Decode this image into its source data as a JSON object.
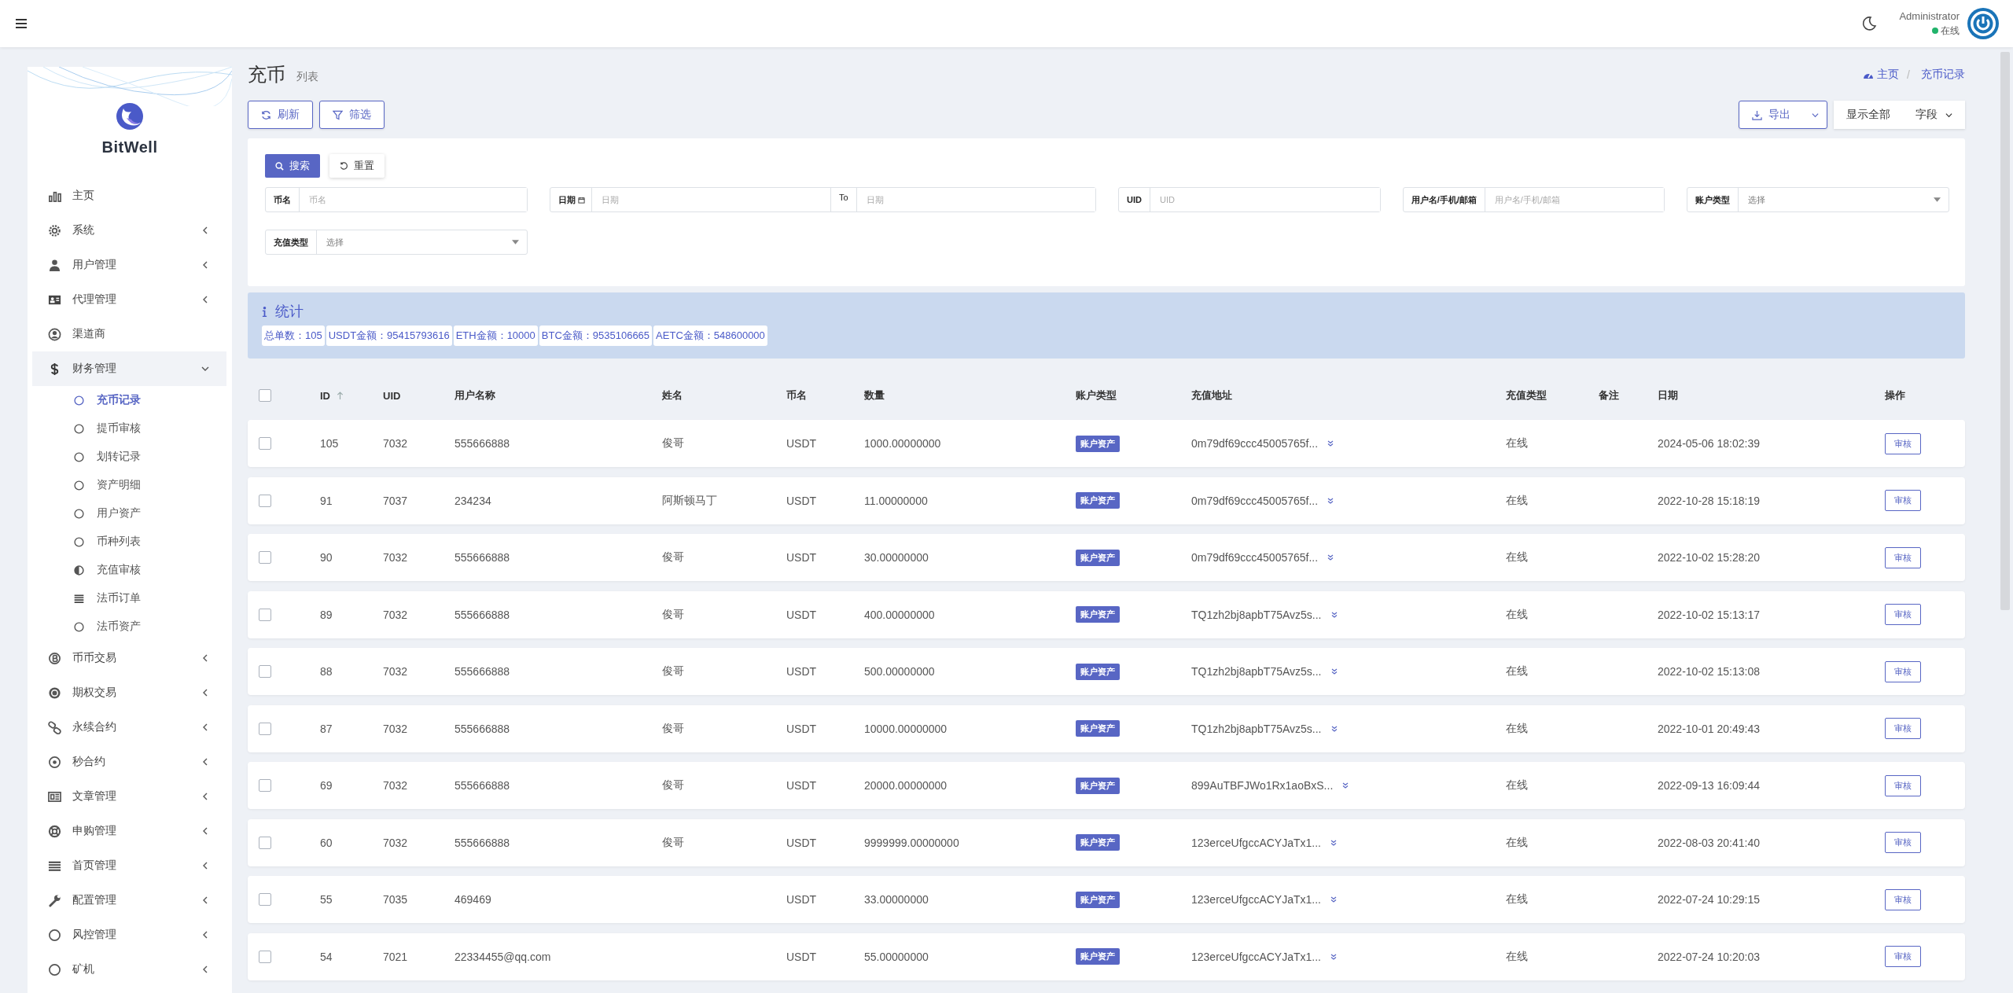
{
  "header": {
    "user": "Administrator",
    "status": "在线",
    "online": true
  },
  "sidebar": {
    "brand": "BitWell",
    "items": [
      {
        "label": "主页",
        "expandable": false
      },
      {
        "label": "系统",
        "expandable": true,
        "expanded": false
      },
      {
        "label": "用户管理",
        "expandable": true,
        "expanded": false
      },
      {
        "label": "代理管理",
        "expandable": true,
        "expanded": false
      },
      {
        "label": "渠道商",
        "expandable": false
      },
      {
        "label": "财务管理",
        "expandable": true,
        "expanded": true,
        "children": [
          {
            "label": "充币记录",
            "selected": true
          },
          {
            "label": "提币审核",
            "selected": false
          },
          {
            "label": "划转记录",
            "selected": false
          },
          {
            "label": "资产明细",
            "selected": false
          },
          {
            "label": "用户资产",
            "selected": false
          },
          {
            "label": "币种列表",
            "selected": false
          },
          {
            "label": "充值审核",
            "selected": false
          },
          {
            "label": "法币订单",
            "selected": false
          },
          {
            "label": "法币资产",
            "selected": false
          }
        ]
      },
      {
        "label": "币币交易",
        "expandable": true,
        "expanded": false
      },
      {
        "label": "期权交易",
        "expandable": true,
        "expanded": false
      },
      {
        "label": "永续合约",
        "expandable": true,
        "expanded": false
      },
      {
        "label": "秒合约",
        "expandable": true,
        "expanded": false
      },
      {
        "label": "文章管理",
        "expandable": true,
        "expanded": false
      },
      {
        "label": "申购管理",
        "expandable": true,
        "expanded": false
      },
      {
        "label": "首页管理",
        "expandable": true,
        "expanded": false
      },
      {
        "label": "配置管理",
        "expandable": true,
        "expanded": false
      },
      {
        "label": "风控管理",
        "expandable": true,
        "expanded": false
      },
      {
        "label": "矿机",
        "expandable": true,
        "expanded": false
      }
    ]
  },
  "page": {
    "title": "充币",
    "subtitle": "列表",
    "breadcrumb": {
      "separator": "/",
      "items": [
        "主页",
        "充币记录"
      ]
    }
  },
  "toolbar": {
    "left": [
      "刷新",
      "筛选"
    ],
    "export": "导出",
    "show_all": "显示全部",
    "fields": "字段"
  },
  "filter": {
    "search": "搜索",
    "reset": "重置",
    "fields": [
      {
        "kind": "text",
        "label": "币名",
        "placeholder": "币名"
      },
      {
        "kind": "daterange",
        "label": "日期",
        "placeholder": "日期",
        "to_label": "To",
        "to_placeholder": "日期"
      },
      {
        "kind": "text",
        "label": "UID",
        "placeholder": "UID"
      },
      {
        "kind": "text",
        "label": "用户名/手机/邮箱",
        "placeholder": "用户名/手机/邮箱"
      },
      {
        "kind": "select",
        "label": "账户类型",
        "placeholder": "选择"
      },
      {
        "kind": "select",
        "label": "充值类型",
        "placeholder": "选择"
      }
    ]
  },
  "stats": {
    "title": "统计",
    "items": [
      "总单数：105",
      "USDT金额：95415793616",
      "ETH金额：10000",
      "BTC金额：9535106665",
      "AETC金额：548600000"
    ]
  },
  "table": {
    "all_checked": false,
    "columns": [
      {
        "label": "ID",
        "sortable": true
      },
      {
        "label": "UID",
        "sortable": false
      },
      {
        "label": "用户名称",
        "sortable": false
      },
      {
        "label": "姓名",
        "sortable": false
      },
      {
        "label": "币名",
        "sortable": false
      },
      {
        "label": "数量",
        "sortable": false
      },
      {
        "label": "账户类型",
        "sortable": false
      },
      {
        "label": "充值地址",
        "sortable": false
      },
      {
        "label": "充值类型",
        "sortable": false
      },
      {
        "label": "备注",
        "sortable": false
      },
      {
        "label": "日期",
        "sortable": false
      },
      {
        "label": "操作",
        "sortable": false
      }
    ],
    "rows": [
      {
        "checked": false,
        "id": "105",
        "uid": "7032",
        "username": "555666888",
        "name": "俊哥",
        "coin": "USDT",
        "amount": "1000.00000000",
        "account_type": "账户资产",
        "address": "0m79df69ccc45005765f...",
        "deposit_type": "在线",
        "date": "2024-05-06 18:02:39",
        "action": "审核"
      },
      {
        "checked": false,
        "id": "91",
        "uid": "7037",
        "username": "234234",
        "name": "阿斯顿马丁",
        "coin": "USDT",
        "amount": "11.00000000",
        "account_type": "账户资产",
        "address": "0m79df69ccc45005765f...",
        "deposit_type": "在线",
        "date": "2022-10-28 15:18:19",
        "action": "审核"
      },
      {
        "checked": false,
        "id": "90",
        "uid": "7032",
        "username": "555666888",
        "name": "俊哥",
        "coin": "USDT",
        "amount": "30.00000000",
        "account_type": "账户资产",
        "address": "0m79df69ccc45005765f...",
        "deposit_type": "在线",
        "date": "2022-10-02 15:28:20",
        "action": "审核"
      },
      {
        "checked": false,
        "id": "89",
        "uid": "7032",
        "username": "555666888",
        "name": "俊哥",
        "coin": "USDT",
        "amount": "400.00000000",
        "account_type": "账户资产",
        "address": "TQ1zh2bj8apbT75Avz5s...",
        "deposit_type": "在线",
        "date": "2022-10-02 15:13:17",
        "action": "审核"
      },
      {
        "checked": false,
        "id": "88",
        "uid": "7032",
        "username": "555666888",
        "name": "俊哥",
        "coin": "USDT",
        "amount": "500.00000000",
        "account_type": "账户资产",
        "address": "TQ1zh2bj8apbT75Avz5s...",
        "deposit_type": "在线",
        "date": "2022-10-02 15:13:08",
        "action": "审核"
      },
      {
        "checked": false,
        "id": "87",
        "uid": "7032",
        "username": "555666888",
        "name": "俊哥",
        "coin": "USDT",
        "amount": "10000.00000000",
        "account_type": "账户资产",
        "address": "TQ1zh2bj8apbT75Avz5s...",
        "deposit_type": "在线",
        "date": "2022-10-01 20:49:43",
        "action": "审核"
      },
      {
        "checked": false,
        "id": "69",
        "uid": "7032",
        "username": "555666888",
        "name": "俊哥",
        "coin": "USDT",
        "amount": "20000.00000000",
        "account_type": "账户资产",
        "address": "899AuTBFJWo1Rx1aoBxS...",
        "deposit_type": "在线",
        "date": "2022-09-13 16:09:44",
        "action": "审核"
      },
      {
        "checked": false,
        "id": "60",
        "uid": "7032",
        "username": "555666888",
        "name": "俊哥",
        "coin": "USDT",
        "amount": "9999999.00000000",
        "account_type": "账户资产",
        "address": "123erceUfgccACYJaTx1...",
        "deposit_type": "在线",
        "date": "2022-08-03 20:41:40",
        "action": "审核"
      },
      {
        "checked": false,
        "id": "55",
        "uid": "7035",
        "username": "469469",
        "coin": "USDT",
        "amount": "33.00000000",
        "account_type": "账户资产",
        "address": "123erceUfgccACYJaTx1...",
        "deposit_type": "在线",
        "date": "2022-07-24 10:29:15",
        "action": "审核"
      },
      {
        "checked": false,
        "id": "54",
        "uid": "7021",
        "username": "22334455@qq.com",
        "coin": "USDT",
        "amount": "55.00000000",
        "account_type": "账户资产",
        "address": "123erceUfgccACYJaTx1...",
        "deposit_type": "在线",
        "date": "2022-07-24 10:20:03",
        "action": "审核"
      }
    ]
  }
}
